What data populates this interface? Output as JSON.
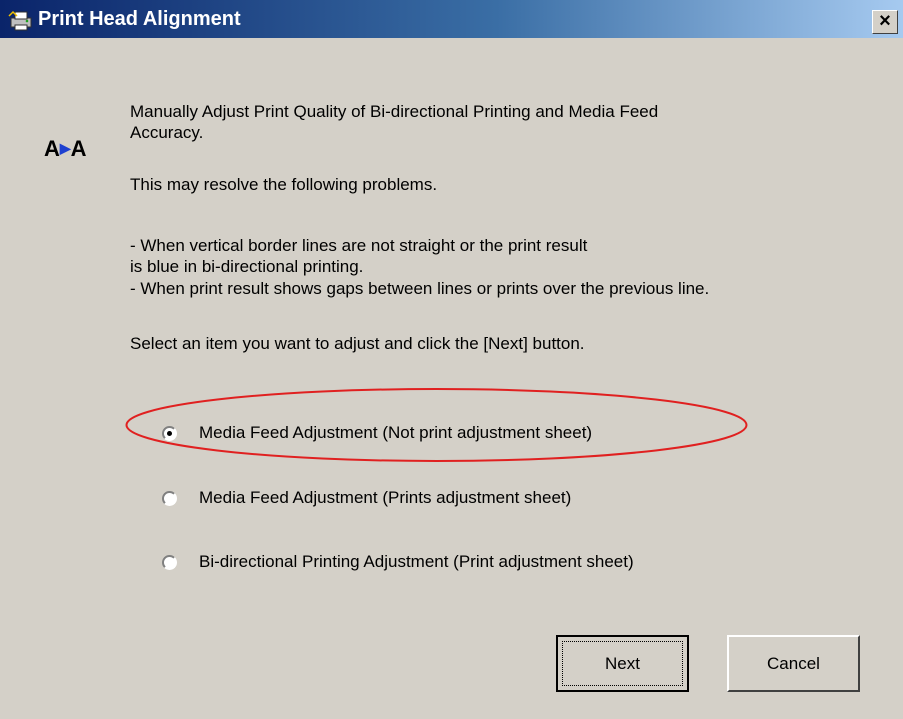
{
  "window": {
    "title": "Print Head Alignment",
    "close_label": "×"
  },
  "logo": {
    "left": "A",
    "right": "A"
  },
  "intro": {
    "line1": "Manually Adjust Print Quality of Bi-directional Printing and Media Feed",
    "line2": "Accuracy.",
    "problems_heading": "This may resolve the following problems.",
    "problem1_line1": "- When vertical border lines are not straight or the print result",
    "problem1_line2": "is blue in bi-directional printing.",
    "problem2": "- When print result shows gaps between lines or prints over the previous line.",
    "instruction": "Select an item you want to adjust and click the [Next] button."
  },
  "options": [
    {
      "label": "Media Feed Adjustment (Not print adjustment sheet)",
      "selected": true
    },
    {
      "label": "Media Feed Adjustment (Prints adjustment sheet)",
      "selected": false
    },
    {
      "label": "Bi-directional Printing Adjustment (Print adjustment sheet)",
      "selected": false
    }
  ],
  "buttons": {
    "next": "Next",
    "cancel": "Cancel"
  },
  "colors": {
    "titlebar_start": "#0a246a",
    "titlebar_end": "#a6caf0",
    "face": "#d4d0c8",
    "highlight": "#e02020"
  }
}
